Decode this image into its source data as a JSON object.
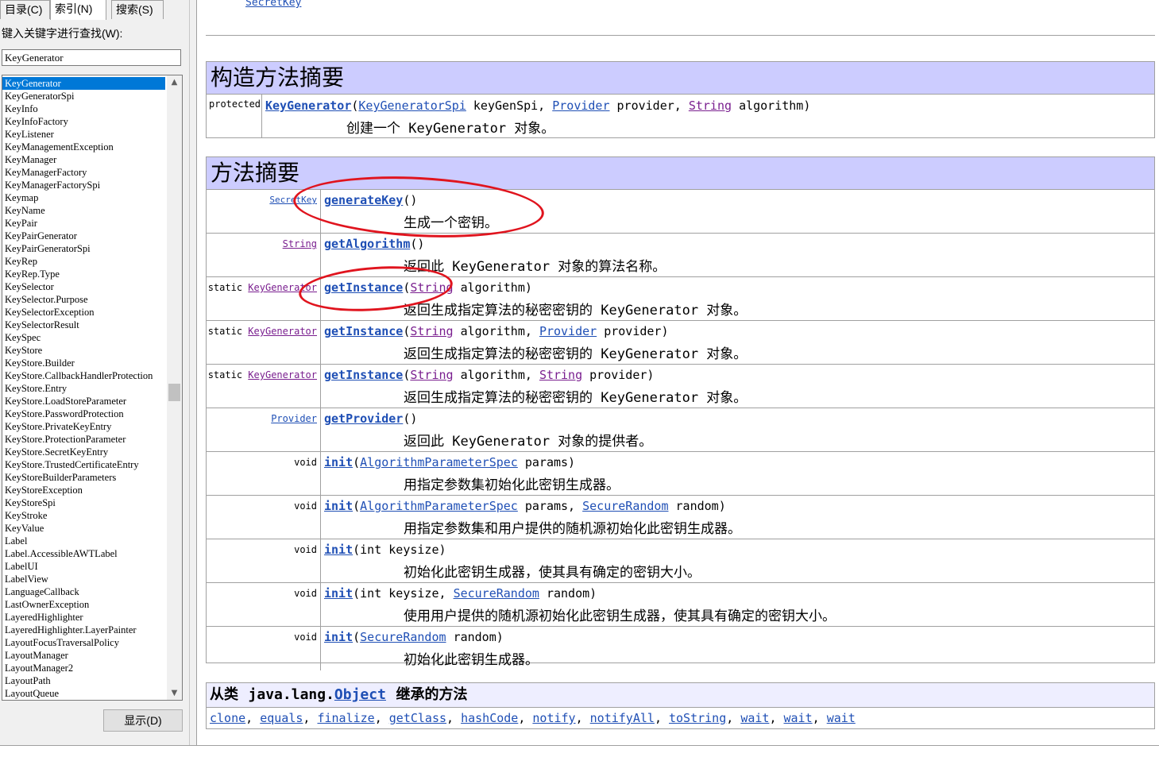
{
  "left_pane": {
    "tabs": [
      "目录(C)",
      "索引(N)",
      "搜索(S)"
    ],
    "keyword_label": "键入关键字进行查找(W):",
    "keyword_value": "KeyGenerator",
    "show_button": "显示(D)",
    "index_items": [
      "KeyGenerator",
      "KeyGeneratorSpi",
      "KeyInfo",
      "KeyInfoFactory",
      "KeyListener",
      "KeyManagementException",
      "KeyManager",
      "KeyManagerFactory",
      "KeyManagerFactorySpi",
      "Keymap",
      "KeyName",
      "KeyPair",
      "KeyPairGenerator",
      "KeyPairGeneratorSpi",
      "KeyRep",
      "KeyRep.Type",
      "KeySelector",
      "KeySelector.Purpose",
      "KeySelectorException",
      "KeySelectorResult",
      "KeySpec",
      "KeyStore",
      "KeyStore.Builder",
      "KeyStore.CallbackHandlerProtection",
      "KeyStore.Entry",
      "KeyStore.LoadStoreParameter",
      "KeyStore.PasswordProtection",
      "KeyStore.PrivateKeyEntry",
      "KeyStore.ProtectionParameter",
      "KeyStore.SecretKeyEntry",
      "KeyStore.TrustedCertificateEntry",
      "KeyStoreBuilderParameters",
      "KeyStoreException",
      "KeyStoreSpi",
      "KeyStroke",
      "KeyValue",
      "Label",
      "Label.AccessibleAWTLabel",
      "LabelUI",
      "LabelView",
      "LanguageCallback",
      "LastOwnerException",
      "LayeredHighlighter",
      "LayeredHighlighter.LayerPainter",
      "LayoutFocusTraversalPolicy",
      "LayoutManager",
      "LayoutManager2",
      "LayoutPath",
      "LayoutQueue"
    ],
    "selected_item": "KeyGenerator"
  },
  "content": {
    "top_link": "SecretKey",
    "constructor_summary": {
      "title": "构造方法摘要",
      "modifier": "protected",
      "name": "KeyGenerator",
      "p1_type": "KeyGeneratorSpi",
      "p1_name": "keyGenSpi,",
      "p2_type": "Provider",
      "p2_name": "provider,",
      "p3_type": "String",
      "p3_name": "algorithm)",
      "description": "创建一个 KeyGenerator 对象。"
    },
    "method_summary": {
      "title": "方法摘要",
      "m1": {
        "ret": "SecretKey",
        "name": "generateKey",
        "params": "()",
        "desc": "生成一个密钥。"
      },
      "m2": {
        "ret": "String",
        "name": "getAlgorithm",
        "params": "()",
        "desc": "返回此 KeyGenerator 对象的算法名称。"
      },
      "m3": {
        "static": "static",
        "ret": "KeyGenerator",
        "name": "getInstance",
        "t1": "String",
        "n1": "algorithm)",
        "desc": "返回生成指定算法的秘密密钥的 KeyGenerator 对象。"
      },
      "m4": {
        "static": "static",
        "ret": "KeyGenerator",
        "name": "getInstance",
        "t1": "String",
        "n1": "algorithm,",
        "t2": "Provider",
        "n2": "provider)",
        "desc": "返回生成指定算法的秘密密钥的 KeyGenerator 对象。"
      },
      "m5": {
        "static": "static",
        "ret": "KeyGenerator",
        "name": "getInstance",
        "t1": "String",
        "n1": "algorithm,",
        "t2": "String",
        "n2": "provider)",
        "desc": "返回生成指定算法的秘密密钥的 KeyGenerator 对象。"
      },
      "m6": {
        "ret": "Provider",
        "name": "getProvider",
        "params": "()",
        "desc": "返回此 KeyGenerator 对象的提供者。"
      },
      "m7": {
        "ret": "void",
        "name": "init",
        "t1": "AlgorithmParameterSpec",
        "n1": "params)",
        "desc": "用指定参数集初始化此密钥生成器。"
      },
      "m8": {
        "ret": "void",
        "name": "init",
        "t1": "AlgorithmParameterSpec",
        "n1": "params,",
        "t2": "SecureRandom",
        "n2": "random)",
        "desc": "用指定参数集和用户提供的随机源初始化此密钥生成器。"
      },
      "m9": {
        "ret": "void",
        "name": "init",
        "params": "(int keysize)",
        "desc": "初始化此密钥生成器，使其具有确定的密钥大小。"
      },
      "m10": {
        "ret": "void",
        "name": "init",
        "pre": "(int keysize,",
        "t2": "SecureRandom",
        "n2": "random)",
        "desc": "使用用户提供的随机源初始化此密钥生成器，使其具有确定的密钥大小。"
      },
      "m11": {
        "ret": "void",
        "name": "init",
        "t1": "SecureRandom",
        "n1": "random)",
        "desc": "初始化此密钥生成器。"
      }
    },
    "inherited": {
      "prefix": "从类",
      "package": "java.lang.",
      "class": "Object",
      "suffix": "继承的方法",
      "methods": [
        "clone",
        "equals",
        "finalize",
        "getClass",
        "hashCode",
        "notify",
        "notifyAll",
        "toString",
        "wait",
        "wait",
        "wait"
      ]
    }
  },
  "colors": {
    "header_bg": "#ccccff",
    "inherit_bg": "#eeeeff",
    "link": "#1f4fb5",
    "visited_link": "#7a1f8f",
    "annotation": "#e0141e",
    "selection": "#0078d7"
  }
}
